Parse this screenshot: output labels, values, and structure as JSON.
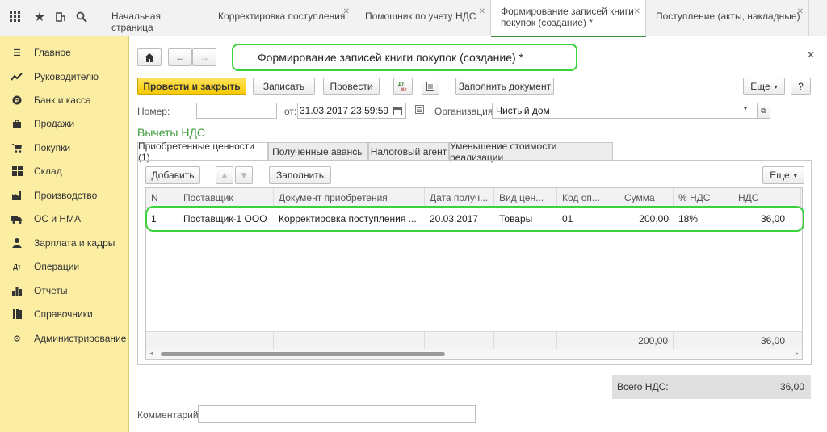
{
  "topbar": {
    "tabs": [
      {
        "label": "Начальная страница",
        "closable": false
      },
      {
        "label": "Корректировка поступления",
        "closable": true
      },
      {
        "label": "Помощник по учету НДС",
        "closable": true
      },
      {
        "label": "Формирование записей книги покупок (создание) *",
        "closable": true,
        "active": true
      },
      {
        "label": "Поступление (акты, накладные)",
        "closable": true
      }
    ]
  },
  "sidebar": {
    "items": [
      {
        "label": "Главное",
        "icon": "menu-icon"
      },
      {
        "label": "Руководителю",
        "icon": "trend-icon"
      },
      {
        "label": "Банк и касса",
        "icon": "coin-icon"
      },
      {
        "label": "Продажи",
        "icon": "bag-icon"
      },
      {
        "label": "Покупки",
        "icon": "cart-icon"
      },
      {
        "label": "Склад",
        "icon": "warehouse-icon"
      },
      {
        "label": "Производство",
        "icon": "factory-icon"
      },
      {
        "label": "ОС и НМА",
        "icon": "truck-icon"
      },
      {
        "label": "Зарплата и кадры",
        "icon": "people-icon"
      },
      {
        "label": "Операции",
        "icon": "dtkt-icon"
      },
      {
        "label": "Отчеты",
        "icon": "chart-icon"
      },
      {
        "label": "Справочники",
        "icon": "books-icon"
      },
      {
        "label": "Администрирование",
        "icon": "gear-icon"
      }
    ]
  },
  "form": {
    "title": "Формирование записей книги покупок (создание) *",
    "toolbar": {
      "post_close": "Провести и закрыть",
      "save": "Записать",
      "post": "Провести",
      "fill_doc": "Заполнить документ",
      "more": "Еще",
      "help": "?"
    },
    "number_label": "Номер:",
    "number_value": "",
    "date_label": "от:",
    "date_value": "31.03.2017 23:59:59",
    "org_label": "Организация:",
    "org_value": "Чистый дом",
    "section_title": "Вычеты НДС",
    "tabs": [
      "Приобретенные ценности (1)",
      "Полученные авансы",
      "Налоговый агент",
      "Уменьшение стоимости реализации"
    ],
    "table_toolbar": {
      "add": "Добавить",
      "fill": "Заполнить",
      "more": "Еще"
    },
    "table": {
      "columns": [
        "N",
        "Поставщик",
        "Документ приобретения",
        "Дата получ...",
        "Вид цен...",
        "Код оп...",
        "Сумма",
        "% НДС",
        "НДС"
      ],
      "rows": [
        {
          "n": "1",
          "supplier": "Поставщик-1 ООО",
          "doc": "Корректировка поступления ...",
          "date": "20.03.2017",
          "kind": "Товары",
          "code": "01",
          "sum": "200,00",
          "rate": "18%",
          "vat": "36,00"
        }
      ],
      "footer": {
        "sum": "200,00",
        "vat": "36,00"
      }
    },
    "total_label": "Всего НДС:",
    "total_value": "36,00",
    "comment_label": "Комментарий:",
    "comment_value": ""
  }
}
